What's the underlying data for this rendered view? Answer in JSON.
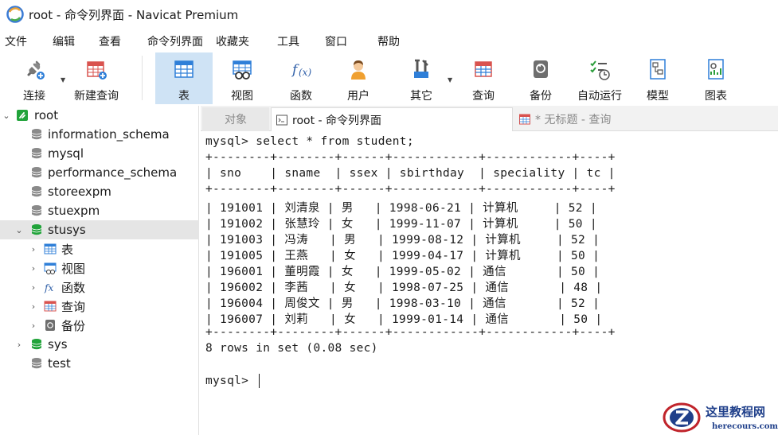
{
  "window": {
    "title": "root - 命令列界面 - Navicat Premium"
  },
  "menu": [
    "文件",
    "编辑",
    "查看",
    "命令列界面",
    "收藏夹",
    "工具",
    "窗口",
    "帮助"
  ],
  "toolbar": {
    "connect": "连接",
    "new_query": "新建查询",
    "table": "表",
    "view": "视图",
    "function": "函数",
    "user": "用户",
    "other": "其它",
    "query": "查询",
    "backup": "备份",
    "autorun": "自动运行",
    "model": "模型",
    "chart": "图表"
  },
  "sidebar": {
    "root": "root",
    "dbs": [
      "information_schema",
      "mysql",
      "performance_schema",
      "storeexpm",
      "stuexpm"
    ],
    "selected_db": "stusys",
    "children": [
      "表",
      "视图",
      "函数",
      "查询",
      "备份"
    ],
    "dbs_after": [
      "sys",
      "test"
    ]
  },
  "tabs": {
    "objects": "对象",
    "console": "root - 命令列界面",
    "query": "* 无标题 - 查询"
  },
  "console": {
    "command": "mysql> select * from student;",
    "border": "+--------+--------+------+------------+------------+----+",
    "header": "| sno    | sname  | ssex | sbirthday  | speciality | tc |",
    "rows": [
      "| 191001 | 刘清泉 | 男   | 1998-06-21 | 计算机     | 52 |",
      "| 191002 | 张慧玲 | 女   | 1999-11-07 | 计算机     | 50 |",
      "| 191003 | 冯涛   | 男   | 1999-08-12 | 计算机     | 52 |",
      "| 191005 | 王燕   | 女   | 1999-04-17 | 计算机     | 50 |",
      "| 196001 | 董明霞 | 女   | 1999-05-02 | 通信       | 50 |",
      "| 196002 | 李茜   | 女   | 1998-07-25 | 通信       | 48 |",
      "| 196004 | 周俊文 | 男   | 1998-03-10 | 通信       | 52 |",
      "| 196007 | 刘莉   | 女   | 1999-01-14 | 通信       | 50 |"
    ],
    "summary": "8 rows in set (0.08 sec)",
    "prompt": "mysql> "
  },
  "watermark": {
    "name": "这里教程网",
    "domain": "herecours.com"
  },
  "colors": {
    "accent_db": "#21a33a",
    "active_tool_bg": "#cfe3f5",
    "selected_row_bg": "#e5e5e5"
  }
}
